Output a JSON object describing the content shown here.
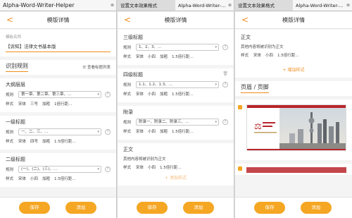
{
  "panel1": {
    "tab_title": "Alpha-Word-Writer-Helper",
    "header_title": "模版详情",
    "template_name_label": "模板名称",
    "template_name_value": "【诉知】法律文书基本版",
    "rules_title": "识别规则",
    "view_titles_link": "查看标题列表",
    "rules": [
      {
        "name": "大纲层层",
        "rule": "第一章、第二章、第三章、…",
        "style": [
          "宋体",
          "三号",
          "加粗",
          "1倍行距…"
        ]
      },
      {
        "name": "一级标题",
        "rule": "一、二、三、…",
        "style": [
          "宋体",
          "四号",
          "加粗",
          "1.5倍行距…"
        ]
      },
      {
        "name": "二级标题",
        "rule": "(一)、(二)、(三)、…",
        "style": [
          "宋体",
          "小四",
          "加粗",
          "1.5倍行距…"
        ]
      }
    ],
    "save_label": "保存",
    "add_label": "添加"
  },
  "panel2": {
    "tab1_title": "设置文本效果格式",
    "tab2_title": "Alpha-Word-Writer-…",
    "header_title": "模版详情",
    "rules": [
      {
        "name": "三级标题",
        "rule": "1、2、3、…",
        "style": [
          "宋体",
          "小四",
          "加粗",
          "1.5倍行距…"
        ]
      },
      {
        "name": "四级标题",
        "rule": "1.1、1.2、1.3、…",
        "style": [
          "宋体",
          "小四",
          "加粗",
          "1.5倍行距…"
        ]
      },
      {
        "name": "附录",
        "rule": "附录一、附录二、附录三、…",
        "style": [
          "宋体",
          "小四",
          "加粗",
          "1.5倍行距…"
        ]
      }
    ],
    "body_title": "正文",
    "body_desc": "其他内容将被识别为正文",
    "body_style": [
      "宋体",
      "小四",
      "1.5倍行距…"
    ],
    "partial_add": "+ 添加样式",
    "save_label": "保存",
    "add_label": "添加"
  },
  "panel3": {
    "tab1_title": "设置文本效果格式",
    "tab2_title": "Alpha-Word-Writer-…",
    "header_title": "模版详情",
    "body_title": "正文",
    "body_desc": "其他内容将被识别为正文",
    "body_style": [
      "宋体",
      "小四",
      "1.5倍行距…"
    ],
    "add_style": "+ 增加样式",
    "header_footer_title": "页眉 / 页脚",
    "save_label": "保存",
    "add_label": "添加"
  },
  "common": {
    "rule_label": "规则",
    "style_label": "样式",
    "help_glyph": "?",
    "back_glyph": "<",
    "close_glyph": "⊗"
  }
}
